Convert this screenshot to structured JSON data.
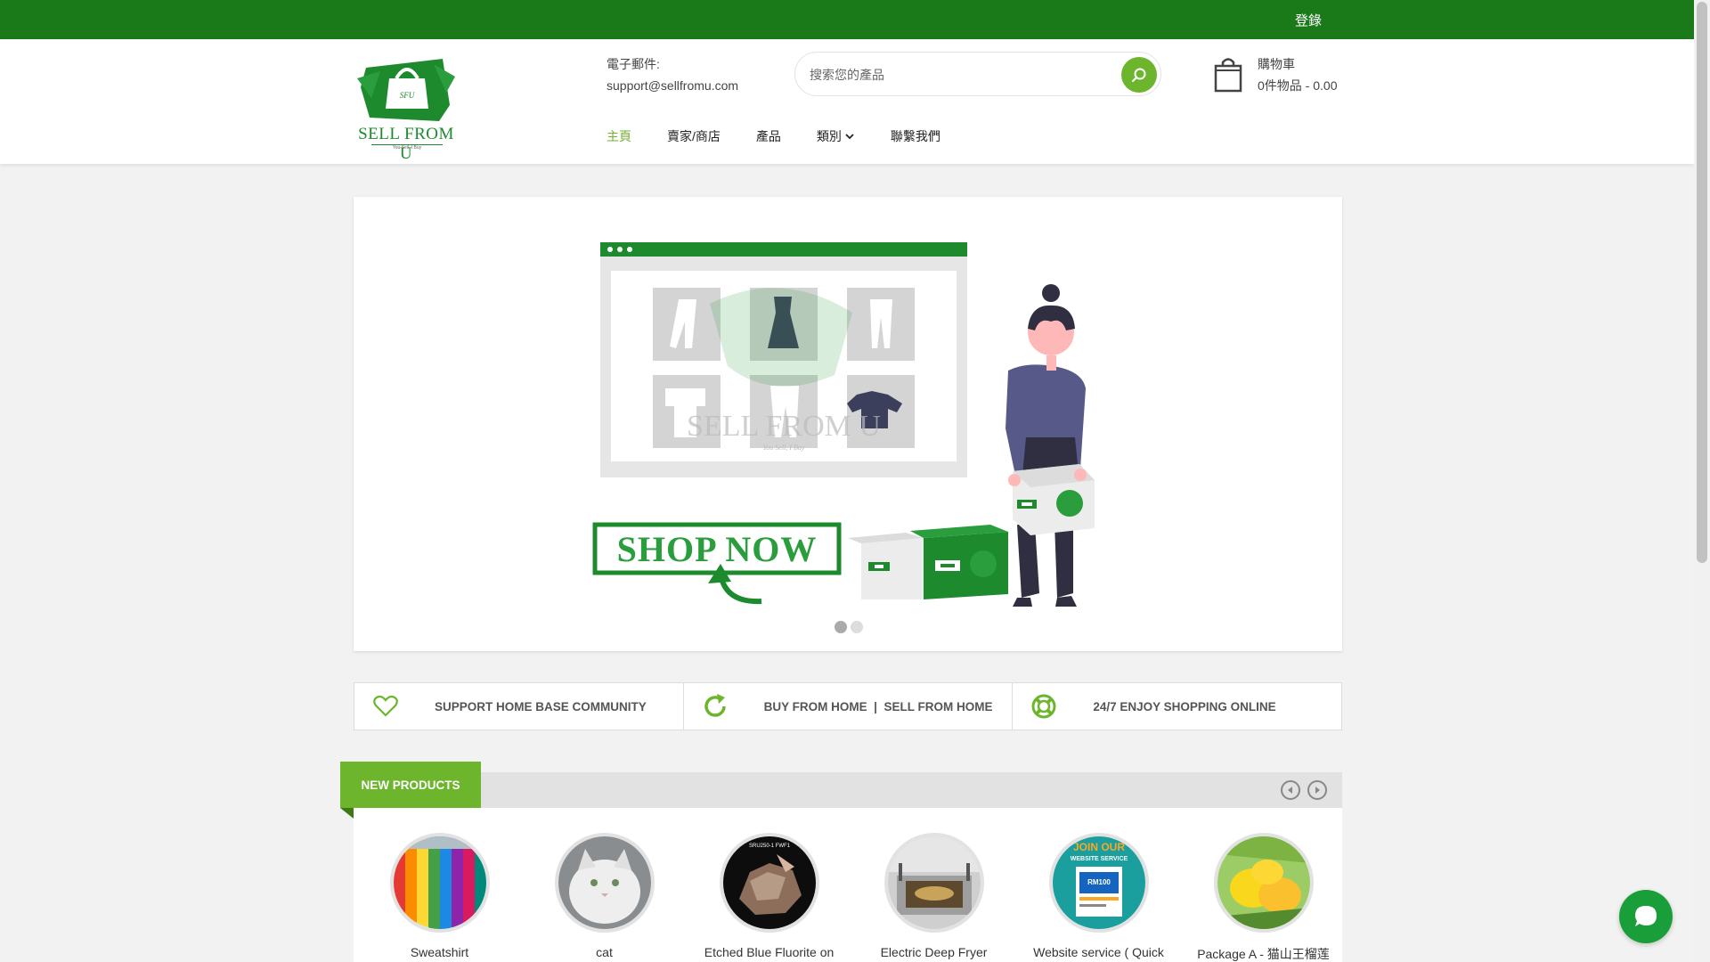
{
  "topbar": {
    "login_label": "登錄"
  },
  "header": {
    "logo": {
      "brand": "SELL FROM U",
      "tagline": "You Sell, I Buy",
      "bag_text": "SFU"
    },
    "email_label": "電子郵件:",
    "email_value": "support@sellfromu.com",
    "search_placeholder": "搜索您的產品",
    "cart": {
      "title": "購物車",
      "summary": "0件物品 - 0.00"
    }
  },
  "nav": {
    "items": [
      {
        "label": "主頁"
      },
      {
        "label": "賣家/商店"
      },
      {
        "label": "產品"
      },
      {
        "label": "類別"
      },
      {
        "label": "聯繫我們"
      }
    ]
  },
  "banner": {
    "cta": "SHOP NOW",
    "watermark": "SELL FROM U",
    "watermark_tagline": "You Sell, I Buy"
  },
  "features": [
    {
      "label": "SUPPORT HOME BASE COMMUNITY",
      "icon": "heart-icon"
    },
    {
      "label": "BUY FROM HOME  |  SELL FROM HOME",
      "icon": "refresh-icon"
    },
    {
      "label": "24/7 ENJOY SHOPPING ONLINE",
      "icon": "lifebuoy-icon"
    }
  ],
  "new_products": {
    "title": "NEW PRODUCTS",
    "items": [
      {
        "name": "Sweatshirt"
      },
      {
        "name": "cat"
      },
      {
        "name": "Etched Blue Fluorite on"
      },
      {
        "name": "Electric Deep Fryer"
      },
      {
        "name": "Website service ( Quick"
      },
      {
        "name": "Package A - 猫山王榴莲"
      }
    ]
  },
  "product_thumbs": {
    "fluorite_label": "SRU250-1 FWF1",
    "website_join": "JOIN OUR",
    "website_service": "WEBSITE SERVICE",
    "website_price": "RM100"
  },
  "colors": {
    "topbar": "#1a7a1a",
    "accent": "#6cb52d",
    "brand_green": "#1e8a2e"
  }
}
